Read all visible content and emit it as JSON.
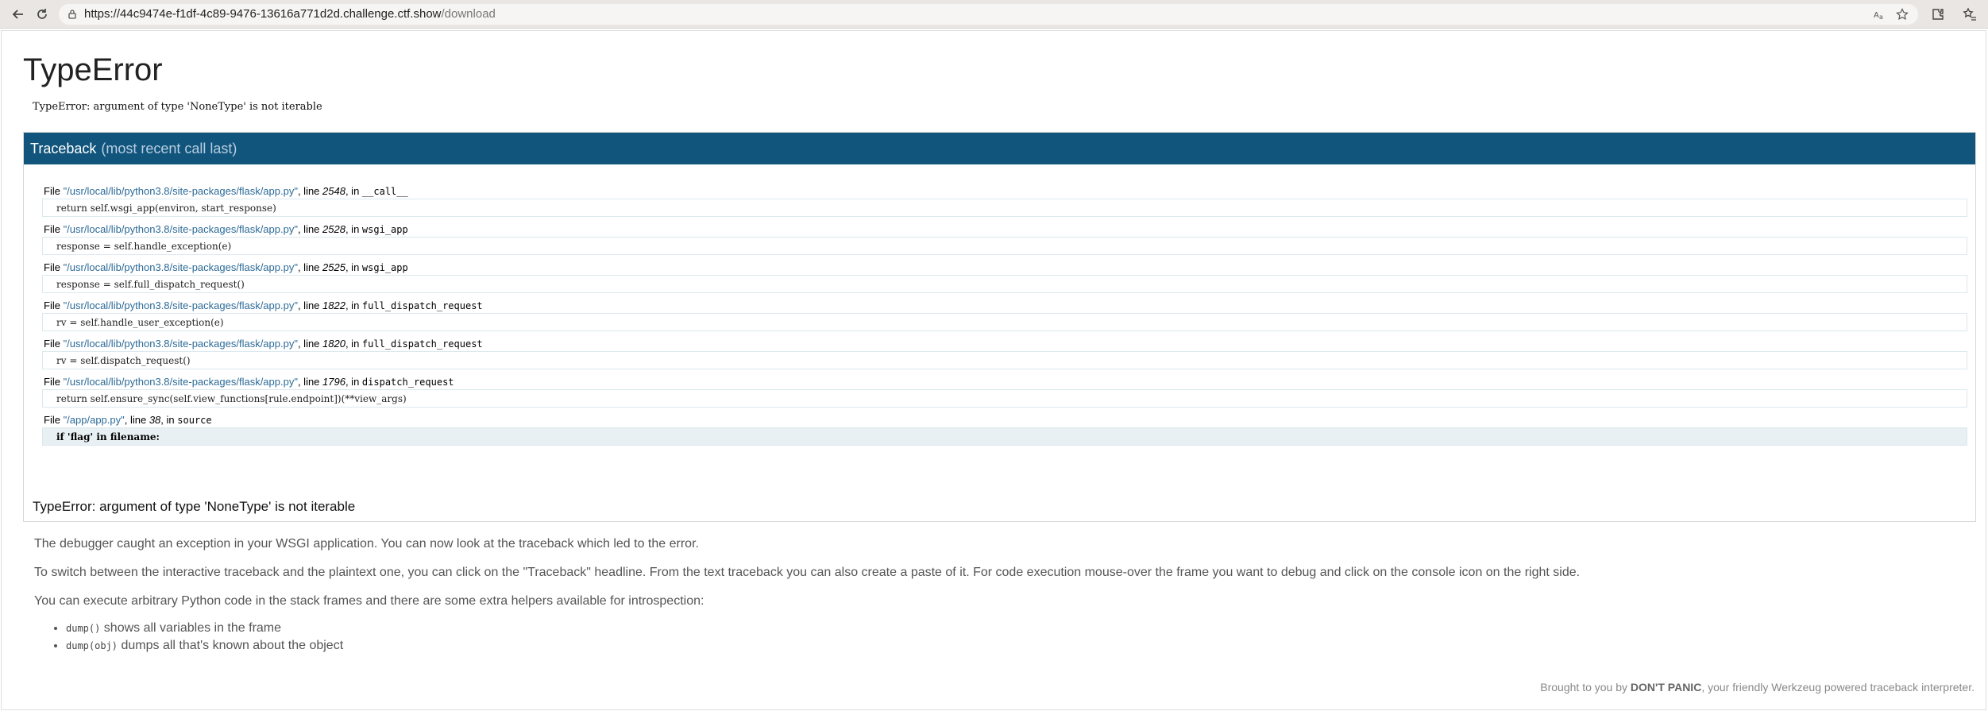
{
  "browser": {
    "url_host": "https://44c9474e-f1df-4c89-9476-13616a771d2d.challenge.ctf.show",
    "url_path": "/download"
  },
  "error": {
    "title": "TypeError",
    "message": "TypeError: argument of type 'NoneType' is not iterable"
  },
  "traceback": {
    "heading": "Traceback",
    "heading_sub": "(most recent call last)",
    "frames": [
      {
        "prefix": "File ",
        "file": "\"/usr/local/lib/python3.8/site-packages/flask/app.py\"",
        "mid": ", line ",
        "line": "2548",
        "in": ", in ",
        "func": "__call__",
        "code": "return self.wsgi_app(environ, start_response)"
      },
      {
        "prefix": "File ",
        "file": "\"/usr/local/lib/python3.8/site-packages/flask/app.py\"",
        "mid": ", line ",
        "line": "2528",
        "in": ", in ",
        "func": "wsgi_app",
        "code": "response = self.handle_exception(e)"
      },
      {
        "prefix": "File ",
        "file": "\"/usr/local/lib/python3.8/site-packages/flask/app.py\"",
        "mid": ", line ",
        "line": "2525",
        "in": ", in ",
        "func": "wsgi_app",
        "code": "response = self.full_dispatch_request()"
      },
      {
        "prefix": "File ",
        "file": "\"/usr/local/lib/python3.8/site-packages/flask/app.py\"",
        "mid": ", line ",
        "line": "1822",
        "in": ", in ",
        "func": "full_dispatch_request",
        "code": "rv = self.handle_user_exception(e)"
      },
      {
        "prefix": "File ",
        "file": "\"/usr/local/lib/python3.8/site-packages/flask/app.py\"",
        "mid": ", line ",
        "line": "1820",
        "in": ", in ",
        "func": "full_dispatch_request",
        "code": "rv = self.dispatch_request()"
      },
      {
        "prefix": "File ",
        "file": "\"/usr/local/lib/python3.8/site-packages/flask/app.py\"",
        "mid": ", line ",
        "line": "1796",
        "in": ", in ",
        "func": "dispatch_request",
        "code": "return self.ensure_sync(self.view_functions[rule.endpoint])(**view_args)"
      },
      {
        "prefix": "File ",
        "file": "\"/app/app.py\"",
        "mid": ", line ",
        "line": "38",
        "in": ", in ",
        "func": "source",
        "code": "if 'flag' in filename:"
      }
    ],
    "final": "TypeError: argument of type 'NoneType' is not iterable"
  },
  "explanation": {
    "p1": "The debugger caught an exception in your WSGI application. You can now look at the traceback which led to the error.",
    "p2": "To switch between the interactive traceback and the plaintext one, you can click on the \"Traceback\" headline. From the text traceback you can also create a paste of it. For code execution mouse-over the frame you want to debug and click on the console icon on the right side.",
    "p3": "You can execute arbitrary Python code in the stack frames and there are some extra helpers available for introspection:",
    "helpers": [
      {
        "code": "dump()",
        "text": " shows all variables in the frame"
      },
      {
        "code": "dump(obj)",
        "text": " dumps all that's known about the object"
      }
    ]
  },
  "footer": {
    "pre": "Brought to you by ",
    "brand": "DON'T PANIC",
    "post": ", your friendly Werkzeug powered traceback interpreter."
  },
  "icons": [
    "back-icon",
    "reload-icon",
    "site-info-icon",
    "translate-icon",
    "bookmark-star-icon",
    "extensions-icon",
    "favorites-icon"
  ]
}
